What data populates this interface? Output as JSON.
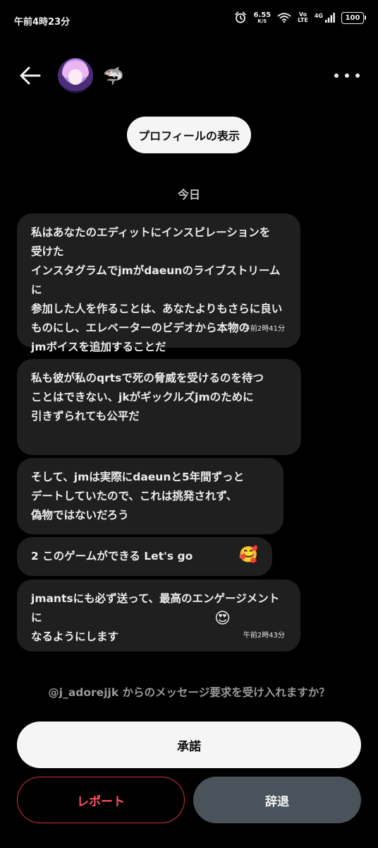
{
  "status_bar": {
    "time": "午前4時23分",
    "net_speed_value": "6.55",
    "net_speed_unit": "K/S",
    "volte_top": "Vo",
    "volte_bottom": "LTE",
    "network": "4G",
    "battery": "100"
  },
  "header": {
    "back_icon": "arrow-left-icon",
    "avatar": "avatar",
    "badge_emoji": "🦈",
    "more_icon": "more-horizontal-icon"
  },
  "view_profile_label": "プロフィールの表示",
  "date_separator": "今日",
  "messages": [
    {
      "text": "私はあなたのエディットにインスピレーションを\n受けた\nインスタグラムでjmがdaeunのライブストリームに\n参加した人を作ることは、あなたよりもさらに良い\nものにし、エレベーターのビデオから本物の\njmボイスを追加することだ",
      "time": "午前2時41分"
    },
    {
      "text": "私も彼が私のqrtsで死の脅威を受けるのを待つ\nことはできない、jkがギックルズjmのために\n引きずられても公平だ"
    },
    {
      "text": "そして、jmは実際にdaeunと5年間ずっと\nデートしていたので、これは挑発されず、\n偽物ではないだろう"
    },
    {
      "text": "2 このゲームができる Let's go",
      "emoji": "🥰"
    },
    {
      "text": "jmantsにも必ず送って、最高のエンゲージメントに\nなるようにします",
      "emoji": "😍",
      "time": "午前2時43分"
    }
  ],
  "request_prompt": "@j_adorejjk からのメッセージ要求を受け入れますか？",
  "actions": {
    "accept": "承諾",
    "report": "レポート",
    "decline": "辞退"
  },
  "colors": {
    "background": "#000000",
    "bubble": "#1f1f1f",
    "report_red": "#ff5260",
    "decline_bg": "#4a535b"
  }
}
